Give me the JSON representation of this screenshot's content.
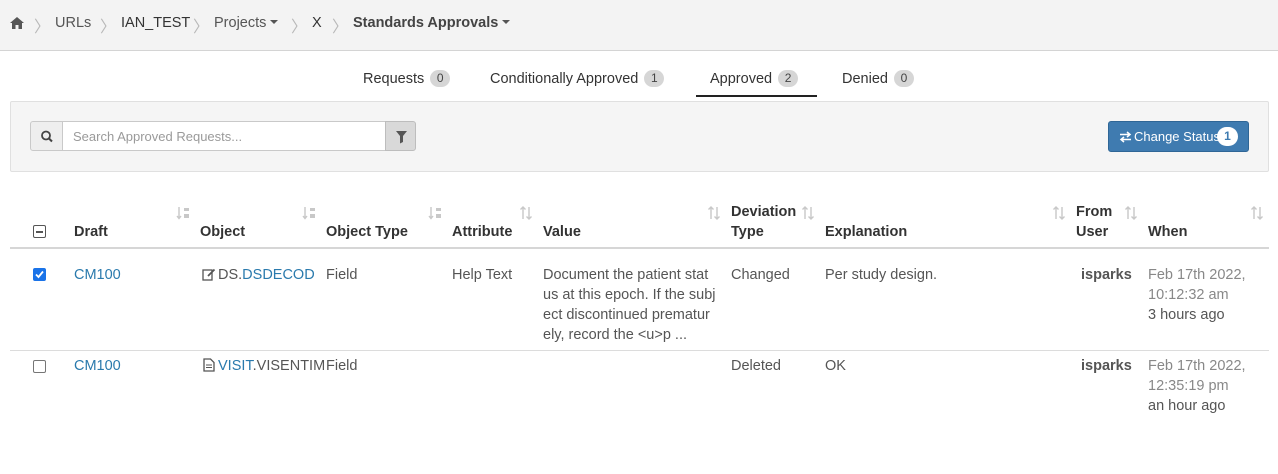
{
  "breadcrumb": {
    "home_icon": "home-icon",
    "items": [
      "URLs",
      "IAN_TEST",
      "Projects",
      "X",
      "Standards Approvals"
    ]
  },
  "tabs": [
    {
      "label": "Requests",
      "count": "0"
    },
    {
      "label": "Conditionally Approved",
      "count": "1"
    },
    {
      "label": "Approved",
      "count": "2",
      "active": true
    },
    {
      "label": "Denied",
      "count": "0"
    }
  ],
  "search": {
    "placeholder": "Search Approved Requests...",
    "value": ""
  },
  "change_status": {
    "label": "Change Status",
    "count": "1"
  },
  "table": {
    "headers": {
      "draft": "Draft",
      "object": "Object",
      "object_type": "Object Type",
      "attribute": "Attribute",
      "value": "Value",
      "deviation_type_1": "Deviation",
      "deviation_type_2": "Type",
      "explanation": "Explanation",
      "from_user_1": "From",
      "from_user_2": "User",
      "when": "When"
    },
    "rows": [
      {
        "checked": true,
        "draft": "CM100",
        "object_icon": "edit-icon",
        "object_prefix": "DS.",
        "object_name": "DSDECOD",
        "object_type": "Field",
        "attribute": "Help Text",
        "value_lines": [
          "Document the patient stat",
          "us at this epoch. If the subj",
          "ect discontinued prematur",
          "ely, record the <u>p ..."
        ],
        "deviation_type": "Changed",
        "explanation": "Per study design.",
        "from_user": "isparks",
        "when_date": "Feb 17th 2022,",
        "when_time": "10:12:32 am",
        "when_relative": "3 hours ago"
      },
      {
        "checked": false,
        "draft": "CM100",
        "object_icon": "document-icon",
        "object_prefix": "VISIT",
        "object_name": ".VISENTIM",
        "object_type": "Field",
        "attribute": "",
        "value_lines": [],
        "deviation_type": "Deleted",
        "explanation": "OK",
        "from_user": "isparks",
        "when_date": "Feb 17th 2022,",
        "when_time": "12:35:19 pm",
        "when_relative": "an hour ago"
      }
    ]
  },
  "colors": {
    "link": "#2a7aad",
    "primary_button": "#3f7bb0",
    "checkbox": "#1a73e8"
  }
}
